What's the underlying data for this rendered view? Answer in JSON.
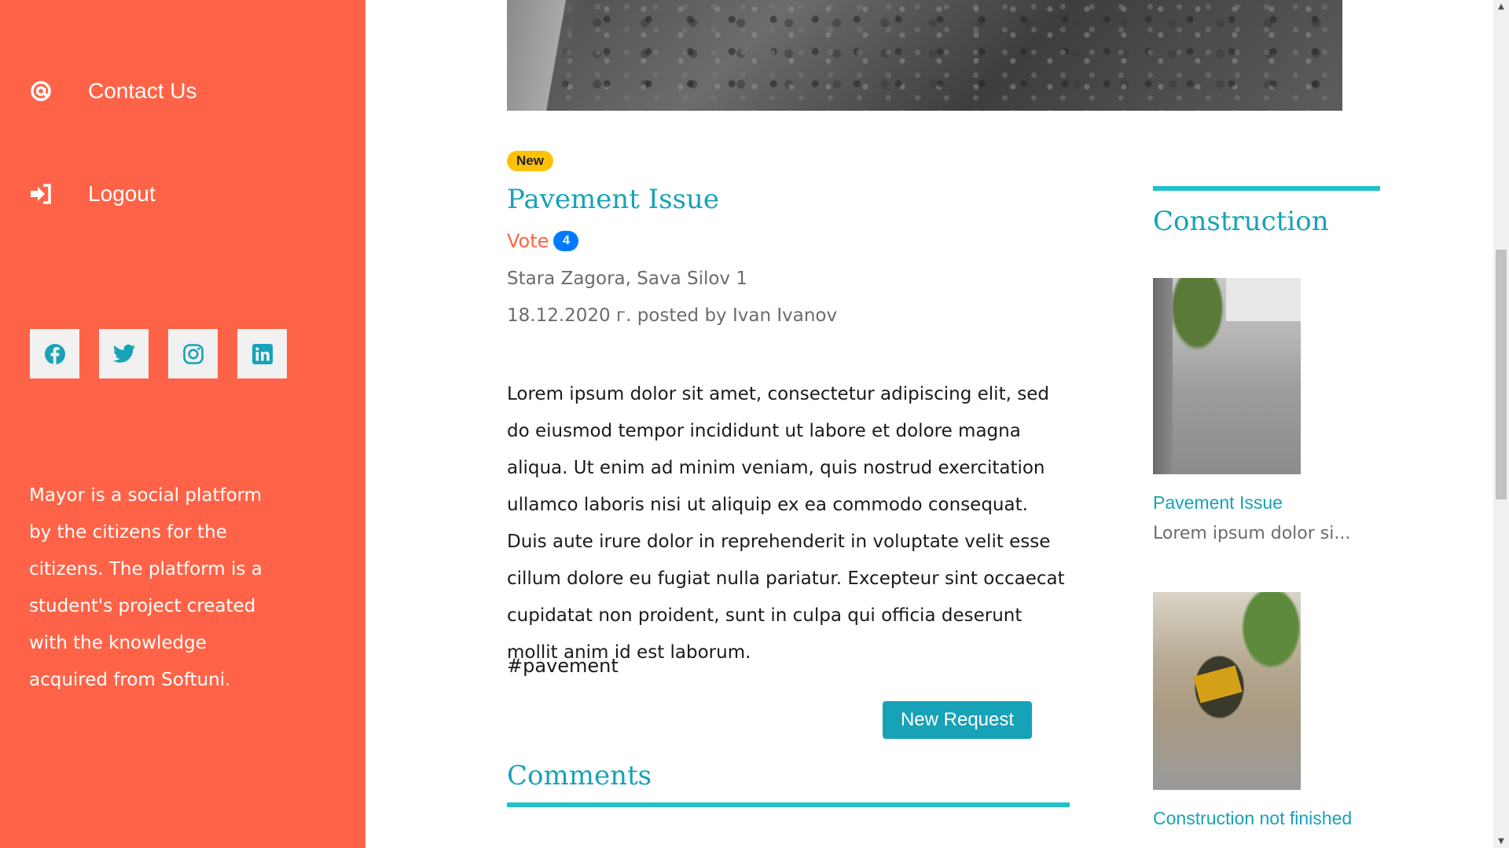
{
  "sidebar": {
    "contact_label": "Contact Us",
    "logout_label": "Logout",
    "social": [
      {
        "name": "facebook-icon"
      },
      {
        "name": "twitter-icon"
      },
      {
        "name": "instagram-icon"
      },
      {
        "name": "linkedin-icon"
      }
    ],
    "about": "Mayor is a social platform by the citizens for the citizens. The platform is a student's project created with the knowledge acquired from Softuni."
  },
  "post": {
    "badge": "New",
    "title": "Pavement Issue",
    "vote_label": "Vote",
    "vote_count": "4",
    "location": "Stara Zagora, Sava Silov 1",
    "posted": "18.12.2020 г. posted by Ivan Ivanov",
    "body": "Lorem ipsum dolor sit amet, consectetur adipiscing elit, sed do eiusmod tempor incididunt ut labore et dolore magna aliqua. Ut enim ad minim veniam, quis nostrud exercitation ullamco laboris nisi ut aliquip ex ea commodo consequat. Duis aute irure dolor in reprehenderit in voluptate velit esse cillum dolore eu fugiat nulla pariatur. Excepteur sint occaecat cupidatat non proident, sunt in culpa qui officia deserunt mollit anim id est laborum.",
    "hashtag": "#pavement",
    "new_request_label": "New Request",
    "comments_title": "Comments"
  },
  "widget": {
    "title": "Construction",
    "cards": [
      {
        "title": "Pavement Issue",
        "excerpt": "Lorem ipsum dolor si..."
      },
      {
        "title": "Construction not finished",
        "excerpt": ""
      }
    ]
  },
  "colors": {
    "sidebar": "#ff6347",
    "accent": "#17a2b8",
    "badge_new": "#ffc107",
    "vote_badge": "#007bff"
  }
}
